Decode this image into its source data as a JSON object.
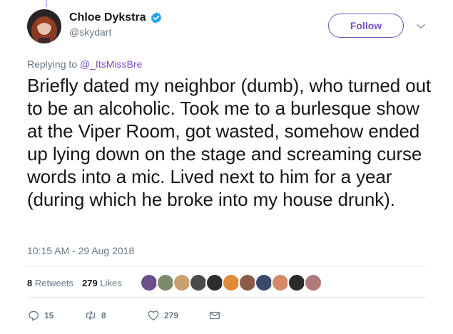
{
  "author": {
    "name": "Chloe Dykstra",
    "handle": "@skydart",
    "verified": true
  },
  "follow_label": "Follow",
  "reply": {
    "prefix": "Replying to",
    "mention": "@_ItsMissBre"
  },
  "tweet_text": "Briefly dated my neighbor (dumb), who turned out to be an alcoholic. Took me to a burlesque show at the Viper Room, got wasted, somehow ended up lying down on the stage and screaming curse words into a mic. Lived next to him for a year (during which he broke into my house drunk).",
  "timestamp": "10:15 AM - 29 Aug 2018",
  "stats": {
    "retweets_count": "8",
    "retweets_label": "Retweets",
    "likes_count": "279",
    "likes_label": "Likes"
  },
  "liker_avatar_colors": [
    "#6b4e8c",
    "#7a8a6a",
    "#c9a070",
    "#4a4a4a",
    "#2d2d2d",
    "#e08a3c",
    "#8b5a4a",
    "#3a4a6a",
    "#d48a6a",
    "#2a2a2a",
    "#b07a7a"
  ],
  "actions": {
    "replies": "15",
    "retweets": "8",
    "likes": "279"
  },
  "colors": {
    "accent": "#794bc4",
    "muted": "#657786",
    "verified": "#1da1f2"
  }
}
